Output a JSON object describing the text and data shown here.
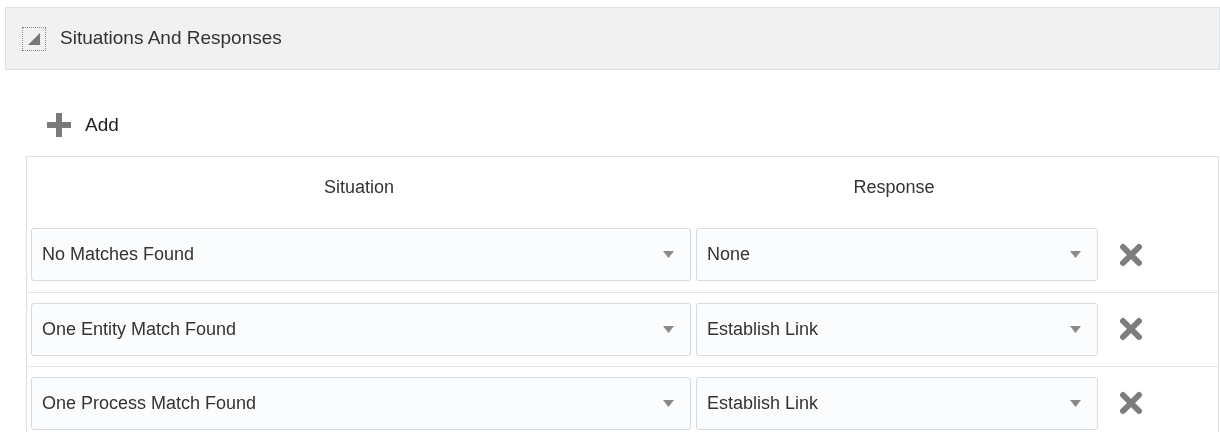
{
  "section": {
    "title": "Situations And Responses",
    "expanded": true
  },
  "toolbar": {
    "add_label": "Add"
  },
  "table": {
    "columns": [
      "Situation",
      "Response"
    ],
    "rows": [
      {
        "situation": "No Matches Found",
        "response": "None"
      },
      {
        "situation": "One Entity Match Found",
        "response": "Establish Link"
      },
      {
        "situation": "One Process Match Found",
        "response": "Establish Link"
      }
    ]
  }
}
